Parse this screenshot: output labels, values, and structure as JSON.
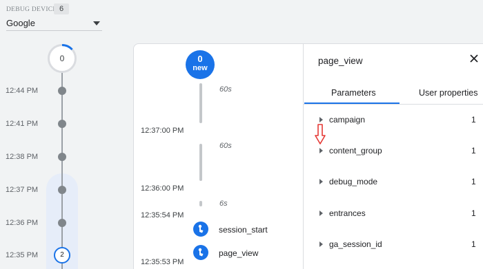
{
  "device": {
    "label": "DEBUG DEVICE",
    "count": "6",
    "selected": "Google"
  },
  "minutes": {
    "top_count": "0",
    "rows": [
      {
        "time": "12:44 PM"
      },
      {
        "time": "12:41 PM"
      },
      {
        "time": "12:38 PM"
      },
      {
        "time": "12:37 PM"
      },
      {
        "time": "12:36 PM"
      },
      {
        "time": "12:35 PM",
        "count": "2"
      }
    ]
  },
  "seconds": {
    "badge_count": "0",
    "badge_text": "new",
    "gaps": [
      "60s",
      "60s",
      "6s"
    ],
    "times": [
      "12:37:00 PM",
      "12:36:00 PM",
      "12:35:54 PM",
      "12:35:53 PM"
    ],
    "events": [
      "session_start",
      "page_view"
    ]
  },
  "panel": {
    "title": "page_view",
    "tabs": [
      "Parameters",
      "User properties"
    ],
    "active_tab": "Parameters",
    "params": [
      {
        "name": "campaign",
        "value": "1"
      },
      {
        "name": "content_group",
        "value": "1"
      },
      {
        "name": "debug_mode",
        "value": "1"
      },
      {
        "name": "entrances",
        "value": "1"
      },
      {
        "name": "ga_session_id",
        "value": "1"
      }
    ]
  },
  "colors": {
    "accent": "#1a73e8",
    "annotation_arrow": "#e53935"
  }
}
